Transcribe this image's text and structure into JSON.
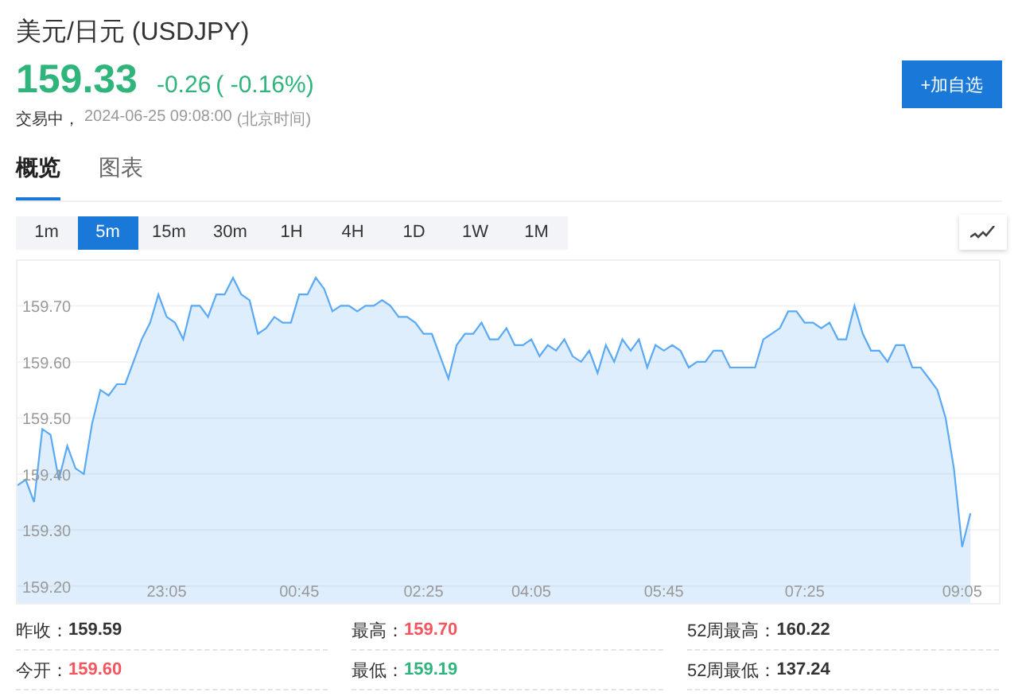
{
  "header": {
    "title": "美元/日元 (USDJPY)",
    "price": "159.33",
    "change": "-0.26",
    "change_percent": "( -0.16%)",
    "color": "#2fb47c",
    "market_status": "交易中，",
    "timestamp": "2024-06-25 09:08:00",
    "timezone": "(北京时间)",
    "watch_button": "+加自选"
  },
  "tabs": [
    {
      "label": "概览",
      "selected": true
    },
    {
      "label": "图表",
      "selected": false
    }
  ],
  "periods": [
    {
      "label": "1m",
      "selected": false
    },
    {
      "label": "5m",
      "selected": true
    },
    {
      "label": "15m",
      "selected": false
    },
    {
      "label": "30m",
      "selected": false
    },
    {
      "label": "1H",
      "selected": false
    },
    {
      "label": "4H",
      "selected": false
    },
    {
      "label": "1D",
      "selected": false
    },
    {
      "label": "1W",
      "selected": false
    },
    {
      "label": "1M",
      "selected": false
    }
  ],
  "chart": {
    "chart_data": {
      "type": "area",
      "categories": [
        null,
        null,
        null,
        null,
        null,
        null,
        null,
        null,
        null,
        null,
        null,
        null,
        null,
        null,
        null,
        null,
        null,
        null,
        "23:05",
        null,
        null,
        null,
        null,
        null,
        null,
        null,
        null,
        null,
        null,
        null,
        null,
        null,
        null,
        null,
        "00:45",
        null,
        null,
        null,
        null,
        null,
        null,
        null,
        null,
        null,
        null,
        null,
        null,
        null,
        null,
        "02:25",
        null,
        null,
        null,
        null,
        null,
        null,
        null,
        null,
        null,
        null,
        null,
        null,
        "04:05",
        null,
        null,
        null,
        null,
        null,
        null,
        null,
        null,
        null,
        null,
        null,
        null,
        null,
        null,
        null,
        "05:45",
        null,
        null,
        null,
        null,
        null,
        null,
        null,
        null,
        null,
        null,
        null,
        null,
        null,
        null,
        null,
        null,
        "07:25",
        null,
        null,
        null,
        null,
        null,
        null,
        null,
        null,
        null,
        null,
        null,
        null,
        null,
        null,
        null,
        null,
        null,
        null,
        "09:05",
        null
      ],
      "series": [
        {
          "color": "#5aa9f5",
          "values": [
            159.38,
            159.39,
            159.35,
            159.48,
            159.47,
            159.39,
            159.45,
            159.41,
            159.4,
            159.49,
            159.55,
            159.54,
            159.56,
            159.56,
            159.6,
            159.64,
            159.67,
            159.72,
            159.68,
            159.67,
            159.64,
            159.7,
            159.7,
            159.68,
            159.72,
            159.72,
            159.75,
            159.72,
            159.71,
            159.65,
            159.66,
            159.68,
            159.67,
            159.67,
            159.72,
            159.72,
            159.75,
            159.73,
            159.69,
            159.7,
            159.7,
            159.69,
            159.7,
            159.7,
            159.71,
            159.7,
            159.68,
            159.68,
            159.67,
            159.65,
            159.65,
            159.61,
            159.57,
            159.63,
            159.65,
            159.65,
            159.67,
            159.64,
            159.64,
            159.66,
            159.63,
            159.63,
            159.64,
            159.61,
            159.63,
            159.62,
            159.64,
            159.61,
            159.6,
            159.62,
            159.58,
            159.63,
            159.6,
            159.64,
            159.62,
            159.64,
            159.59,
            159.63,
            159.62,
            159.63,
            159.62,
            159.59,
            159.6,
            159.6,
            159.62,
            159.62,
            159.59,
            159.59,
            159.59,
            159.59,
            159.64,
            159.65,
            159.66,
            159.69,
            159.69,
            159.67,
            159.67,
            159.66,
            159.67,
            159.64,
            159.64,
            159.7,
            159.65,
            159.62,
            159.62,
            159.6,
            159.63,
            159.63,
            159.59,
            159.59,
            159.57,
            159.55,
            159.5,
            159.41,
            159.27,
            159.33
          ]
        }
      ],
      "ylim": [
        159.17,
        159.78
      ],
      "grid": true,
      "yticks": [
        {
          "value": 159.2,
          "label": "159.20"
        },
        {
          "value": 159.3,
          "label": "159.30"
        },
        {
          "value": 159.4,
          "label": "159.40"
        },
        {
          "value": 159.5,
          "label": "159.50"
        },
        {
          "value": 159.6,
          "label": "159.60"
        },
        {
          "value": 159.7,
          "label": "159.70"
        }
      ]
    }
  },
  "stats": [
    {
      "label": "昨收：",
      "value": "159.59",
      "color": "#333333"
    },
    {
      "label": "最高：",
      "value": "159.70",
      "color": "#f5555f"
    },
    {
      "label": "52周最高：",
      "value": "160.22",
      "color": "#333333"
    },
    {
      "label": "今开：",
      "value": "159.60",
      "color": "#f5555f"
    },
    {
      "label": "最低：",
      "value": "159.19",
      "color": "#2fb47c"
    },
    {
      "label": "52周最低：",
      "value": "137.24",
      "color": "#333333"
    }
  ]
}
